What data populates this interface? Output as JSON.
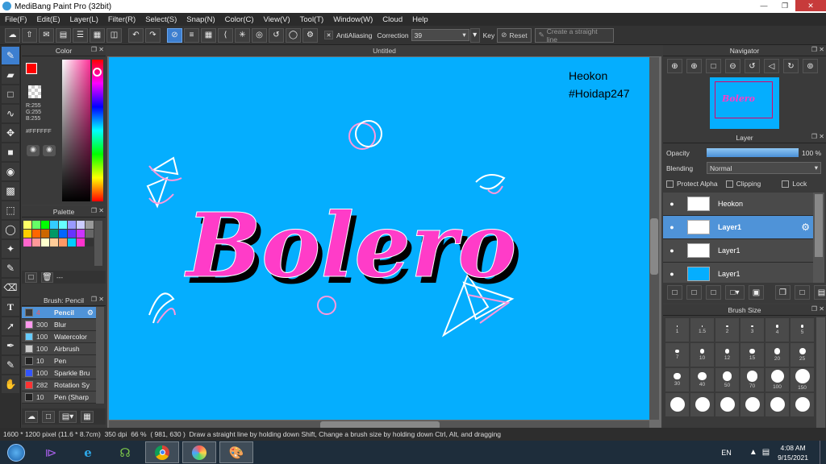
{
  "window": {
    "title": "MediBang Paint Pro (32bit)"
  },
  "menu": [
    "File(F)",
    "Edit(E)",
    "Layer(L)",
    "Filter(R)",
    "Select(S)",
    "Snap(N)",
    "Color(C)",
    "View(V)",
    "Tool(T)",
    "Window(W)",
    "Cloud",
    "Help"
  ],
  "toolbar": {
    "antialiasing_label": "AntiAliasing",
    "correction_label": "Correction",
    "correction_value": "39",
    "key_label": "Key",
    "reset_label": "Reset",
    "straight_line_label": "Create a straight line"
  },
  "color_panel": {
    "title": "Color",
    "r": "R:255",
    "g": "G:255",
    "b": "B:255",
    "hex": "#FFFFFF",
    "primary": "#ff0000",
    "secondary": "#f7941d"
  },
  "palette_panel": {
    "title": "Palette",
    "add_value": "---",
    "swatches": [
      "#ffff66",
      "#66ff66",
      "#00ff00",
      "#33ccff",
      "#66ffff",
      "#9999ff",
      "#ccccff",
      "#999999",
      "#ffcc00",
      "#ff6600",
      "#cc6600",
      "#009966",
      "#0066ff",
      "#6633ff",
      "#cc33ff",
      "#666666",
      "#ff66cc",
      "#ff9999",
      "#ffffcc",
      "#ffcc99",
      "#ff9966",
      "#00ccff",
      "#ff33cc",
      "#333333"
    ]
  },
  "brush_panel": {
    "title": "Brush: Pencil",
    "brushes": [
      {
        "size": "4",
        "name": "Pencil",
        "color": "#3a3a3a"
      },
      {
        "size": "300",
        "name": "Blur",
        "color": "#ff99ee"
      },
      {
        "size": "100",
        "name": "Watercolor",
        "color": "#66ccff"
      },
      {
        "size": "100",
        "name": "Airbrush",
        "color": "#cccccc"
      },
      {
        "size": "10",
        "name": "Pen",
        "color": "#222222"
      },
      {
        "size": "100",
        "name": "Sparkle Bru",
        "color": "#3355ff"
      },
      {
        "size": "282",
        "name": "Rotation Sy",
        "color": "#ff3333"
      },
      {
        "size": "10",
        "name": "Pen (Sharp",
        "color": "#222222"
      }
    ]
  },
  "document": {
    "title": "Untitled"
  },
  "canvas_text": {
    "author": "Heokon",
    "tag": "#Hoidap247",
    "word": "Bolero"
  },
  "navigator": {
    "title": "Navigator"
  },
  "layer_panel": {
    "title": "Layer",
    "opacity_label": "Opacity",
    "opacity_value": "100 %",
    "opacity_fraction": 1.0,
    "blending_label": "Blending",
    "blending_value": "Normal",
    "protect_alpha": "Protect Alpha",
    "clipping": "Clipping",
    "lock": "Lock",
    "layers": [
      {
        "name": "Heokon",
        "selected": false
      },
      {
        "name": "Layer1",
        "selected": true
      },
      {
        "name": "Layer1",
        "selected": false
      },
      {
        "name": "Layer1",
        "selected": false
      }
    ]
  },
  "brush_size_panel": {
    "title": "Brush Size",
    "sizes": [
      "1",
      "1.5",
      "2",
      "3",
      "4",
      "5",
      "7",
      "10",
      "12",
      "15",
      "20",
      "25",
      "30",
      "40",
      "50",
      "70",
      "100",
      "150",
      "",
      "",
      "",
      "",
      "",
      ""
    ]
  },
  "status": {
    "dimensions": "1600 * 1200 pixel",
    "physical": "(11.6 * 8.7cm)",
    "dpi": "350 dpi",
    "zoom": "66 %",
    "coords": "( 981, 630 )",
    "hint": "Draw a straight line by holding down Shift, Change a brush size by holding down Ctrl, Alt, and dragging"
  },
  "taskbar": {
    "lang": "EN",
    "time": "4:08 AM",
    "date": "9/15/2021"
  }
}
